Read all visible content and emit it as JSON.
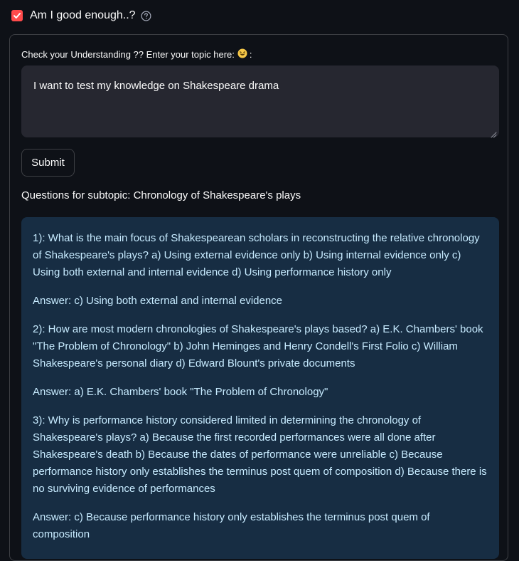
{
  "checkbox": {
    "label": "Am I good enough..?",
    "checked": true,
    "accent_color": "#ff4b4b"
  },
  "help_icon": "question-circle-icon",
  "input": {
    "label": "Check your Understanding ?? Enter your topic here:",
    "emoji": "😆",
    "label_suffix": ":",
    "value": "I want to test my knowledge on Shakespeare drama"
  },
  "submit": {
    "label": "Submit"
  },
  "result": {
    "heading": "Questions for subtopic: Chronology of Shakespeare's plays",
    "items": [
      "1): What is the main focus of Shakespearean scholars in reconstructing the relative chronology of Shakespeare's plays? a) Using external evidence only b) Using internal evidence only c) Using both external and internal evidence d) Using performance history only",
      "Answer: c) Using both external and internal evidence",
      "2): How are most modern chronologies of Shakespeare's plays based? a) E.K. Chambers' book \"The Problem of Chronology\" b) John Heminges and Henry Condell's First Folio c) William Shakespeare's personal diary d) Edward Blount's private documents",
      "Answer: a) E.K. Chambers' book \"The Problem of Chronology\"",
      "3): Why is performance history considered limited in determining the chronology of Shakespeare's plays? a) Because the first recorded performances were all done after Shakespeare's death b) Because the dates of performance were unreliable c) Because performance history only establishes the terminus post quem of composition d) Because there is no surviving evidence of performances",
      "Answer: c) Because performance history only establishes the terminus post quem of composition"
    ]
  },
  "colors": {
    "background": "#0e1117",
    "input_bg": "#262730",
    "info_bg": "#172d43",
    "info_text": "#c7ebff"
  }
}
